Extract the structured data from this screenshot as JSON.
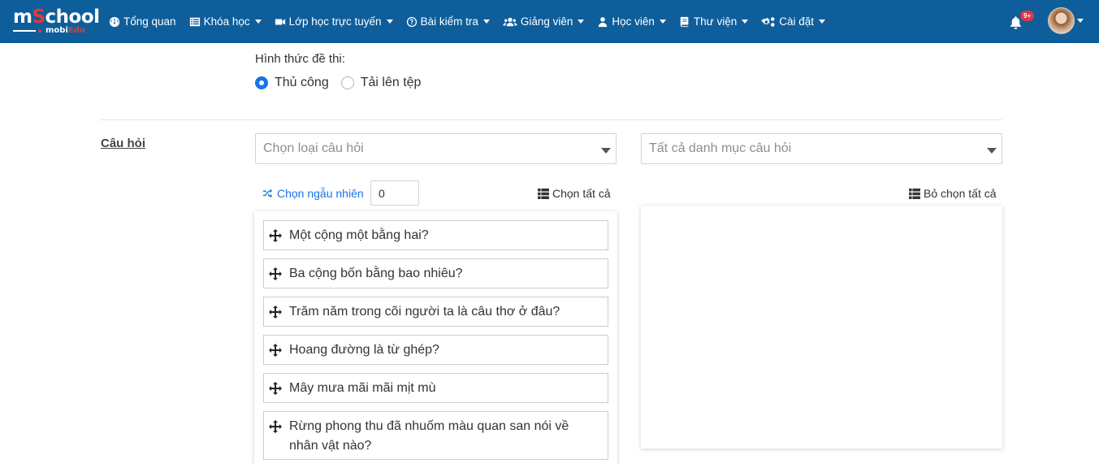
{
  "brand": {
    "main_pre": "m",
    "main_o": "S",
    "main_post": "chool",
    "sub_pre": "mobi",
    "sub_red": "Edu"
  },
  "nav": {
    "items": [
      {
        "label": "Tổng quan",
        "icon": "dashboard-icon",
        "dropdown": false
      },
      {
        "label": "Khóa học",
        "icon": "list-icon",
        "dropdown": true
      },
      {
        "label": "Lớp học trực tuyến",
        "icon": "video-icon",
        "dropdown": true
      },
      {
        "label": "Bài kiểm tra",
        "icon": "question-circle-icon",
        "dropdown": true
      },
      {
        "label": "Giảng viên",
        "icon": "users-icon",
        "dropdown": true
      },
      {
        "label": "Học viên",
        "icon": "user-icon",
        "dropdown": true
      },
      {
        "label": "Thư viện",
        "icon": "book-icon",
        "dropdown": true
      },
      {
        "label": "Cài đặt",
        "icon": "cogs-icon",
        "dropdown": true
      }
    ],
    "notifications_badge": "9+"
  },
  "exam_format": {
    "label": "Hình thức đề thi:",
    "options": [
      {
        "label": "Thủ công",
        "selected": true
      },
      {
        "label": "Tải lên tệp",
        "selected": false
      }
    ]
  },
  "questions_section": {
    "label": "Câu hỏi",
    "type_select_placeholder": "Chọn loại câu hỏi",
    "category_select_placeholder": "Tất cả danh mục câu hỏi",
    "random_label": "Chọn ngẫu nhiên",
    "random_count": "0",
    "select_all_label": "Chọn tất cả",
    "deselect_all_label": "Bỏ chọn tất cả",
    "available": [
      "Một cộng một bằng hai?",
      "Ba cộng bốn bằng bao nhiêu?",
      "Trăm năm trong cõi người ta là câu thơ ở đâu?",
      "Hoang đường là từ ghép?",
      "Mây mưa mãi mãi mịt mù",
      "Rừng phong thu đã nhuốm màu quan san nói về nhân vật nào?"
    ],
    "selected": []
  },
  "colors": {
    "navbar": "#0e5e9b",
    "accent": "#1a73e8",
    "badge": "#dc3545"
  }
}
